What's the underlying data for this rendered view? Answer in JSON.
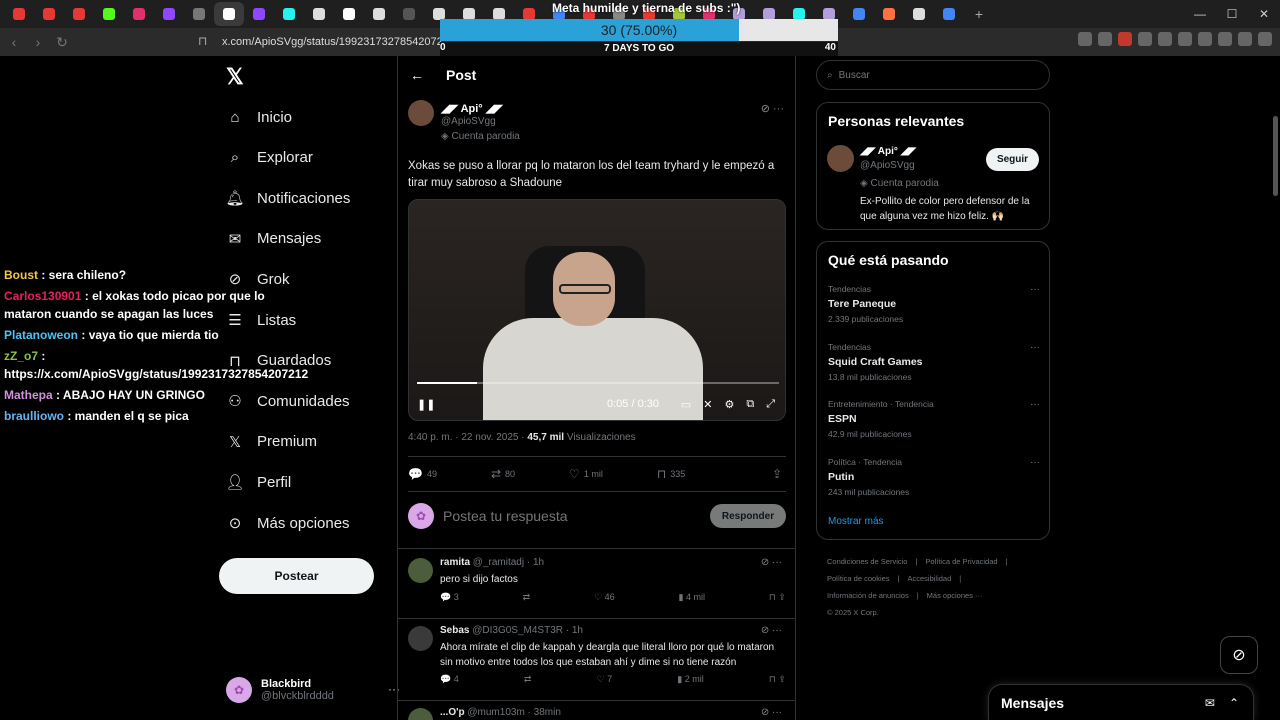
{
  "browser": {
    "tab_icons": [
      "youtube-icon",
      "youtube-icon",
      "youtube-icon",
      "kick-icon",
      "instagram-icon",
      "twitch-icon",
      "audio-icon",
      "x-icon",
      "twitch-icon",
      "tiktok-icon",
      "x-alt-icon",
      "x-icon",
      "x-alt-icon",
      "drive-icon",
      "x-alt-icon",
      "x-alt-icon",
      "x-alt-icon",
      "youtube-icon",
      "google-icon",
      "youtube-icon",
      "share-icon",
      "youtube-icon",
      "android-icon",
      "instagram-icon",
      "feather-icon",
      "feather-icon",
      "tiktok-icon",
      "feather-icon",
      "google-icon",
      "chart-icon",
      "x-alt-icon",
      "google-icon"
    ],
    "url": "x.com/ApioSVgg/status/1992317327854207212"
  },
  "overlay": {
    "title": "Meta humilde y tierna de subs :\")",
    "goal_text": "30 (75.00%)",
    "goal_fraction": 0.75,
    "min": "0",
    "max": "40",
    "days": "7 DAYS TO GO"
  },
  "nav": {
    "items": [
      {
        "label": "Inicio",
        "icon": "home-icon"
      },
      {
        "label": "Explorar",
        "icon": "search-icon"
      },
      {
        "label": "Notificaciones",
        "icon": "bell-icon"
      },
      {
        "label": "Mensajes",
        "icon": "mail-icon"
      },
      {
        "label": "Grok",
        "icon": "grok-icon"
      },
      {
        "label": "Listas",
        "icon": "list-icon"
      },
      {
        "label": "Guardados",
        "icon": "bookmark-icon"
      },
      {
        "label": "Comunidades",
        "icon": "communities-icon"
      },
      {
        "label": "Premium",
        "icon": "x-icon"
      },
      {
        "label": "Perfil",
        "icon": "person-icon"
      },
      {
        "label": "Más opciones",
        "icon": "more-circle-icon"
      }
    ],
    "post_button": "Postear",
    "user_name": "Blackbird",
    "user_handle": "@blvckblrdddd"
  },
  "chat": [
    {
      "user": "Boust",
      "user_color": "#f5c542",
      "text": "sera chileno?"
    },
    {
      "user": "Carlos130901",
      "user_color": "#e91e63",
      "text": "el xokas todo picao por que lo mataron cuando se apagan las luces"
    },
    {
      "user": "Platanoweon",
      "user_color": "#4fc3f7",
      "text": "vaya tio que mierda tio"
    },
    {
      "user": "zZ_o7",
      "user_color": "#8bc34a",
      "text": "https://x.com/ApioSVgg/status/1992317327854207212"
    },
    {
      "user": "Mathepa",
      "user_color": "#ce93d8",
      "text": "ABAJO HAY UN GRINGO"
    },
    {
      "user": "braulliowo",
      "user_color": "#64b5f6",
      "text": "manden el q se pica"
    }
  ],
  "post": {
    "header": "Post",
    "author_name": "◢◤ Api° ◢◤",
    "author_handle": "@ApioSVgg",
    "parody": "Cuenta parodia",
    "text": "Xokas se puso a llorar pq lo mataron los del team tryhard y le empezó a tirar muy sabroso a Shadoune",
    "video_time": "0:05 / 0:30",
    "video_progress": 0.167,
    "timestamp": "4:40 p. m. · 22 nov. 2025 ·",
    "views": "45,7 mil",
    "views_label": "Visualizaciones",
    "replies": "49",
    "reposts": "80",
    "likes": "1 mil",
    "bookmarks": "335",
    "reply_placeholder": "Postea tu respuesta",
    "reply_button": "Responder"
  },
  "comments": [
    {
      "name": "ramita",
      "handle": "@_ramitadj · 1h",
      "text": "pero si dijo factos",
      "replies": "3",
      "likes": "46",
      "views": "4 mil"
    },
    {
      "name": "Sebas",
      "handle": "@DI3G0S_M4ST3R · 1h",
      "text": "Ahora mírate el clip de kappah y deargla que literal lloro por qué lo mataron sin motivo entre todos los que estaban ahí y dime si no tiene razón",
      "replies": "4",
      "likes": "7",
      "views": "2 mil"
    },
    {
      "name": "...O'p",
      "handle": "@mum103m · 38min",
      "text": "",
      "replies": "",
      "likes": "",
      "views": ""
    }
  ],
  "right": {
    "search_placeholder": "Buscar",
    "relevant_title": "Personas relevantes",
    "rel_name": "◢◤ Api° ◢◤",
    "rel_handle": "@ApioSVgg",
    "rel_parody": "Cuenta parodia",
    "rel_bio": "Ex-Pollito de color pero defensor de la que alguna vez me hizo feliz. 🙌🏻",
    "follow": "Seguir",
    "trending_title": "Qué está pasando",
    "trends": [
      {
        "cat": "Tendencias",
        "name": "Tere Paneque",
        "count": "2.339 publicaciones"
      },
      {
        "cat": "Tendencias",
        "name": "Squid Craft Games",
        "count": "13,8 mil publicaciones"
      },
      {
        "cat": "Entretenimiento · Tendencia",
        "name": "ESPN",
        "count": "42,9 mil publicaciones"
      },
      {
        "cat": "Política · Tendencia",
        "name": "Putin",
        "count": "243 mil publicaciones"
      }
    ],
    "show_more": "Mostrar más",
    "footer": [
      "Condiciones de Servicio",
      "|",
      "Política de Privacidad",
      "|",
      "Política de cookies",
      "|",
      "Accesibilidad",
      "|",
      "Información de anuncios",
      "|",
      "Más opciones ···",
      "© 2025 X Corp."
    ]
  },
  "messages": {
    "title": "Mensajes"
  },
  "colors": {
    "accent": "#1d9bf0",
    "goal": "#2aa2d8",
    "background": "#000000"
  }
}
